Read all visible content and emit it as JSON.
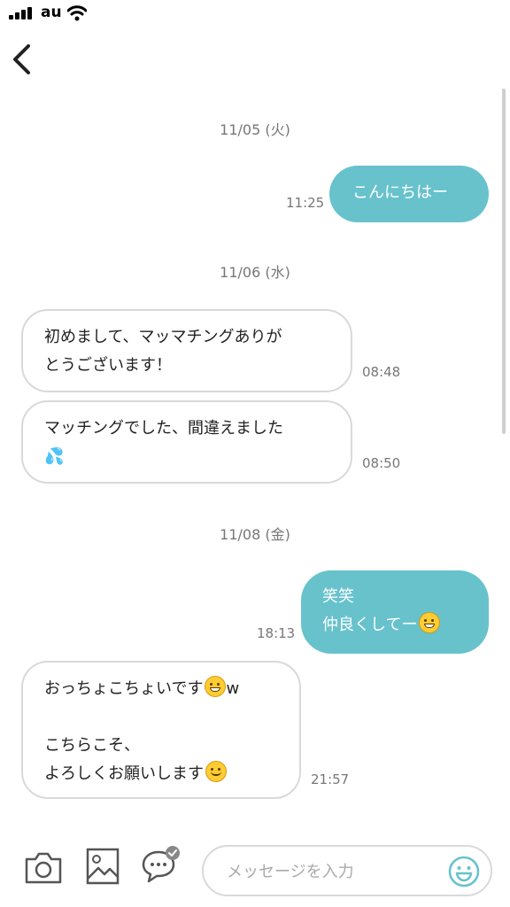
{
  "status_bar": {
    "carrier": "au"
  },
  "colors": {
    "accent": "#67c2cc",
    "outgoing_text": "#ffffff",
    "meta_text": "#777777"
  },
  "messages": [
    {
      "date": "11/05 (火)"
    },
    {
      "direction": "out",
      "lines": [
        "こんにちはー"
      ],
      "time": "11:25"
    },
    {
      "date": "11/06 (水)"
    },
    {
      "direction": "in",
      "lines": [
        "初めまして、マッマチングありが",
        "とうございます！"
      ],
      "time": "08:48"
    },
    {
      "direction": "in",
      "lines": [
        "マッチングでした、間違えました",
        "💦"
      ],
      "time": "08:50"
    },
    {
      "date": "11/08 (金)"
    },
    {
      "direction": "out",
      "lines": [
        "笑笑",
        "仲良くしてー"
      ],
      "emoji": "grinning-sweat-face",
      "time": "18:13"
    },
    {
      "direction": "in",
      "lines": [
        "おっちょこちょいです",
        "w",
        "こちらこそ、",
        "よろしくお願いします"
      ],
      "time": "21:57"
    }
  ],
  "composer": {
    "placeholder": "メッセージを入力",
    "icons": [
      "camera-icon",
      "image-icon",
      "chat-bubble-icon",
      "emoji-icon"
    ]
  }
}
